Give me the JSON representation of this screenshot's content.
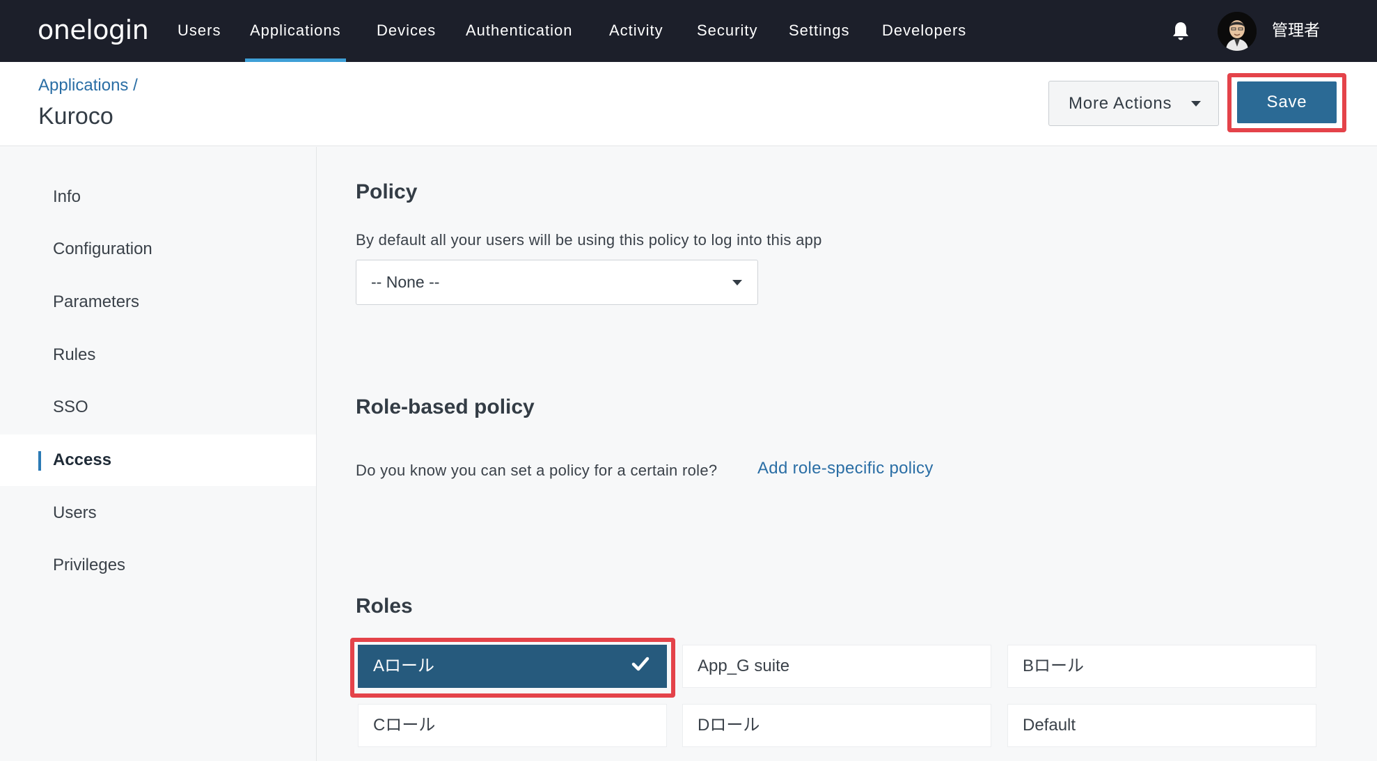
{
  "brand": {
    "logo_text": "onelogin"
  },
  "nav": {
    "items": [
      {
        "label": "Users"
      },
      {
        "label": "Applications",
        "active": true
      },
      {
        "label": "Devices"
      },
      {
        "label": "Authentication"
      },
      {
        "label": "Activity"
      },
      {
        "label": "Security"
      },
      {
        "label": "Settings"
      },
      {
        "label": "Developers"
      }
    ],
    "notification_icon": "bell-icon",
    "user": {
      "name": "管理者",
      "avatar_icon": "avatar"
    }
  },
  "header": {
    "breadcrumb": "Applications /",
    "title": "Kuroco",
    "more_actions_label": "More Actions",
    "save_label": "Save"
  },
  "sidebar": {
    "items": [
      {
        "label": "Info"
      },
      {
        "label": "Configuration"
      },
      {
        "label": "Parameters"
      },
      {
        "label": "Rules"
      },
      {
        "label": "SSO"
      },
      {
        "label": "Access",
        "active": true
      },
      {
        "label": "Users"
      },
      {
        "label": "Privileges"
      }
    ]
  },
  "policy": {
    "heading": "Policy",
    "description": "By default all your users will be using this policy to log into this app",
    "select_value": "-- None --"
  },
  "role_policy": {
    "heading": "Role-based policy",
    "description": "Do you know you can set a policy for a certain role?",
    "link_label": "Add role-specific policy"
  },
  "roles": {
    "heading": "Roles",
    "items": [
      {
        "label": "Aロール",
        "selected": true
      },
      {
        "label": "App_G suite",
        "selected": false
      },
      {
        "label": "Bロール",
        "selected": false
      },
      {
        "label": "Cロール",
        "selected": false
      },
      {
        "label": "Dロール",
        "selected": false
      },
      {
        "label": "Default",
        "selected": false
      }
    ]
  },
  "colors": {
    "topbar": "#1c1f2a",
    "accent": "#3e9fd6",
    "primary_button": "#2b6a95",
    "selected_role": "#265a7d",
    "highlight": "#e4434a",
    "link": "#2a6ea5"
  }
}
